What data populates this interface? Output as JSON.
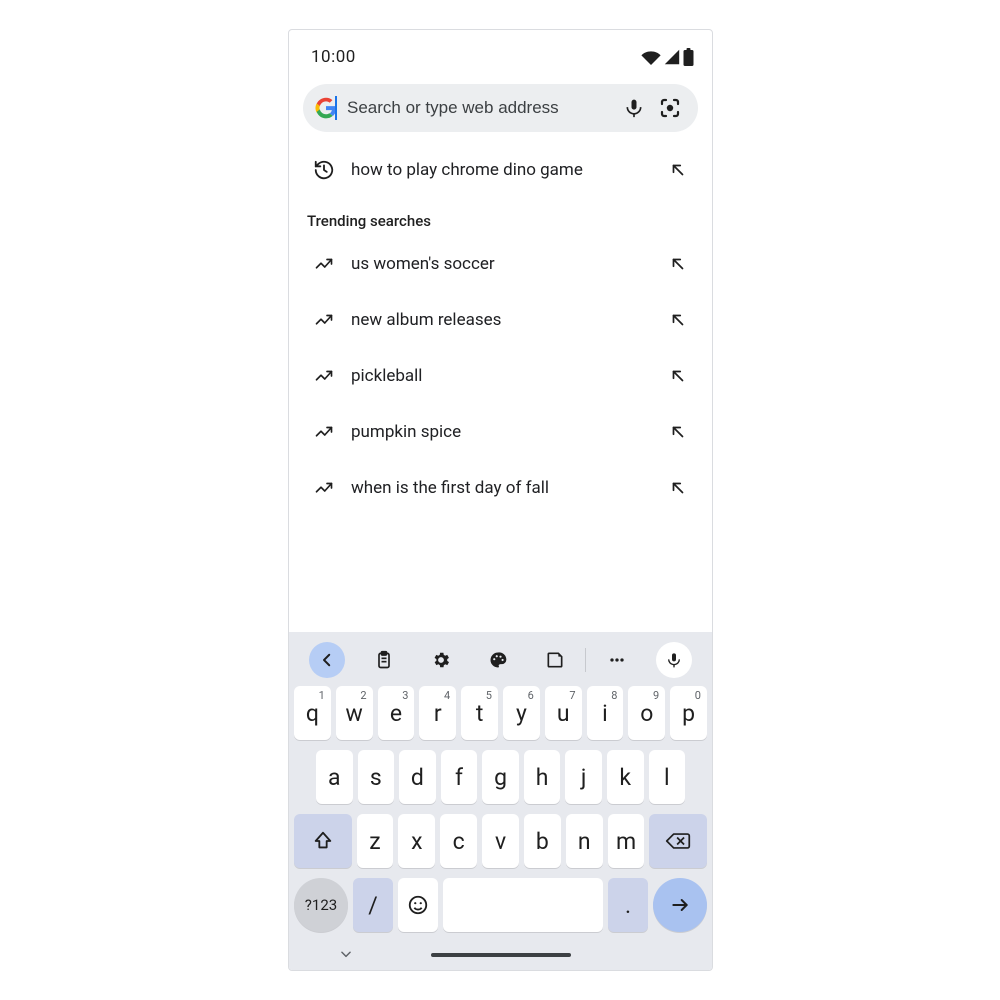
{
  "status": {
    "time": "10:00"
  },
  "omnibox": {
    "placeholder": "Search or type web address"
  },
  "history_row": {
    "label": "how to play chrome dino game"
  },
  "trending": {
    "title": "Trending searches",
    "items": [
      {
        "label": "us women's soccer"
      },
      {
        "label": "new album releases"
      },
      {
        "label": "pickleball"
      },
      {
        "label": "pumpkin spice"
      },
      {
        "label": "when is the first day of fall"
      }
    ]
  },
  "keyboard": {
    "row1": [
      {
        "k": "q",
        "n": "1"
      },
      {
        "k": "w",
        "n": "2"
      },
      {
        "k": "e",
        "n": "3"
      },
      {
        "k": "r",
        "n": "4"
      },
      {
        "k": "t",
        "n": "5"
      },
      {
        "k": "y",
        "n": "6"
      },
      {
        "k": "u",
        "n": "7"
      },
      {
        "k": "i",
        "n": "8"
      },
      {
        "k": "o",
        "n": "9"
      },
      {
        "k": "p",
        "n": "0"
      }
    ],
    "row2": [
      {
        "k": "a"
      },
      {
        "k": "s"
      },
      {
        "k": "d"
      },
      {
        "k": "f"
      },
      {
        "k": "g"
      },
      {
        "k": "h"
      },
      {
        "k": "j"
      },
      {
        "k": "k"
      },
      {
        "k": "l"
      }
    ],
    "row3": [
      {
        "k": "z"
      },
      {
        "k": "x"
      },
      {
        "k": "c"
      },
      {
        "k": "v"
      },
      {
        "k": "b"
      },
      {
        "k": "n"
      },
      {
        "k": "m"
      }
    ],
    "sym": "?123",
    "slash": "/",
    "period": "."
  }
}
